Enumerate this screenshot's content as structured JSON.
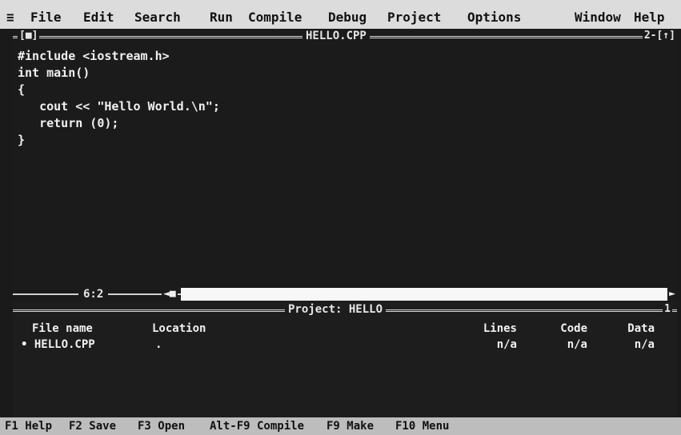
{
  "menu": {
    "system_glyph": "≡",
    "items": [
      "File",
      "Edit",
      "Search",
      "Run",
      "Compile",
      "Debug",
      "Project",
      "Options",
      "Window",
      "Help"
    ]
  },
  "editor": {
    "close_box": "[■]",
    "title": "HELLO.CPP",
    "window_number": "2-[↑]",
    "code_lines": [
      "#include <iostream.h>",
      "int main()",
      "{",
      "   cout << \"Hello World.\\n\";",
      "   return (0);",
      "}"
    ],
    "cursor_position": "6:2",
    "scroll_left": "◄■",
    "scroll_right": "►"
  },
  "project": {
    "title": "Project: HELLO",
    "window_number": "1",
    "columns": {
      "file_name": "File name",
      "location": "Location",
      "lines": "Lines",
      "code": "Code",
      "data": "Data"
    },
    "rows": [
      {
        "file_name": "• HELLO.CPP",
        "location": ".",
        "lines": "n/a",
        "code": "n/a",
        "data": "n/a"
      }
    ]
  },
  "fkeys": [
    "F1 Help",
    "F2 Save",
    "F3 Open",
    "Alt-F9 Compile",
    "F9 Make",
    "F10 Menu"
  ]
}
